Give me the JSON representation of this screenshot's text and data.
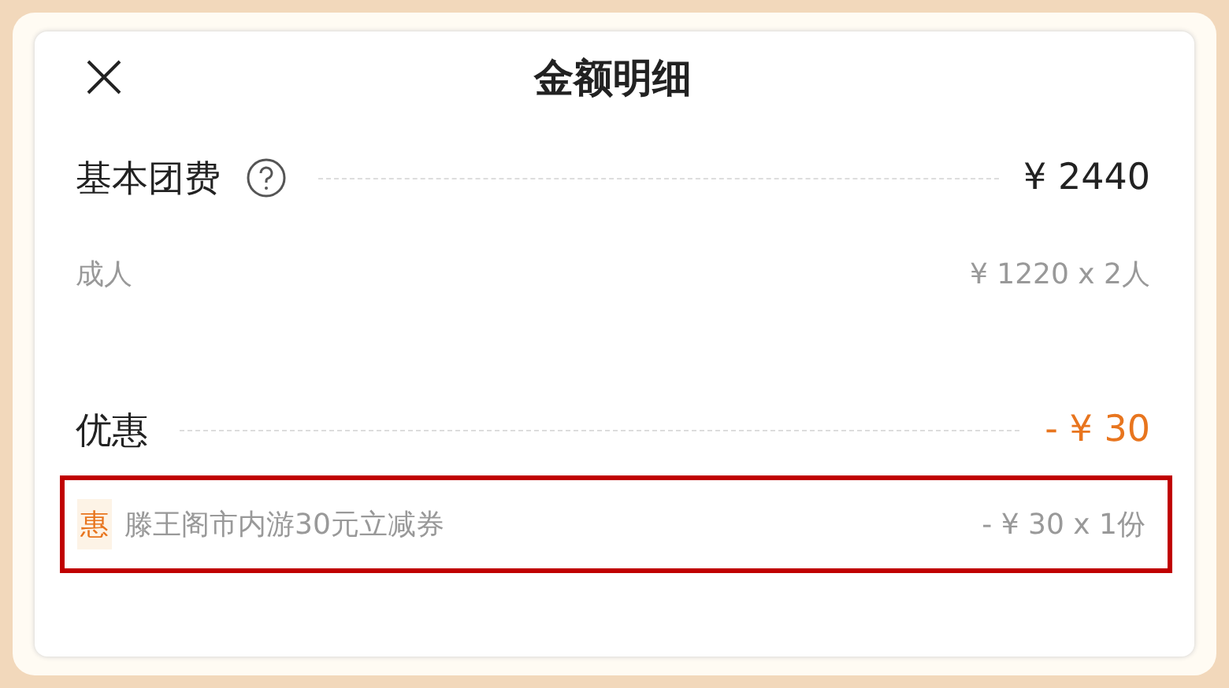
{
  "header": {
    "title": "金额明细"
  },
  "base_fee": {
    "label": "基本团费",
    "amount": "¥ 2440",
    "details": [
      {
        "label": "成人",
        "amount": "¥ 1220 x 2人"
      }
    ]
  },
  "discount": {
    "label": "优惠",
    "amount": "- ¥ 30",
    "coupons": [
      {
        "badge": "惠",
        "name": "滕王阁市内游30元立减券",
        "amount": "- ¥ 30 x 1份",
        "highlighted": true
      }
    ]
  }
}
